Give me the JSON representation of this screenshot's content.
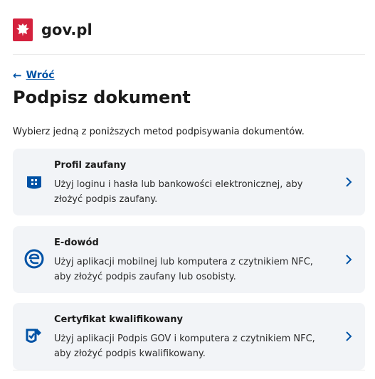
{
  "header": {
    "brand": "gov.pl",
    "emblem_icon": "polish-eagle-emblem",
    "emblem_color": "#d4213d"
  },
  "nav": {
    "back_label": "Wróć",
    "back_icon": "arrow-left-icon"
  },
  "page": {
    "title": "Podpisz dokument",
    "intro": "Wybierz jedną z poniższych metod podpisywania dokumentów."
  },
  "methods": [
    {
      "title": "Profil zaufany",
      "description": "Użyj loginu i hasła lub bankowości elektronicznej, aby złożyć podpis zaufany.",
      "icon": "trusted-profile-icon"
    },
    {
      "title": "E-dowód",
      "description": "Użyj aplikacji mobilnej lub komputera z czytnikiem NFC, aby złożyć podpis zaufany lub osobisty.",
      "icon": "e-id-icon"
    },
    {
      "title": "Certyfikat kwalifikowany",
      "description": "Użyj aplikacji Podpis GOV i komputera z czytnikiem NFC, aby złożyć podpis kwalifikowany.",
      "icon": "qualified-certificate-icon"
    }
  ],
  "colors": {
    "accent": "#0052a5",
    "card_bg": "#f2f4f7",
    "text": "#1b1b1b"
  }
}
